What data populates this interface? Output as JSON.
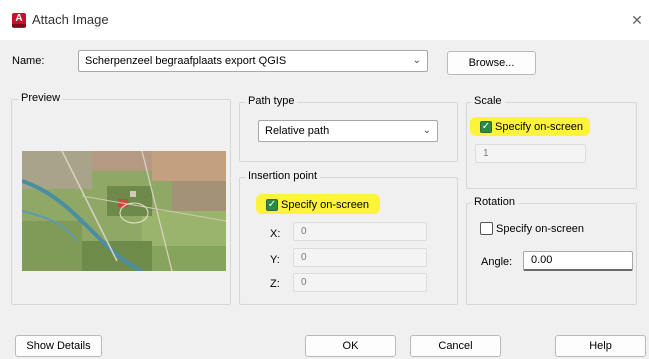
{
  "window": {
    "title": "Attach Image",
    "close_icon": "close-icon"
  },
  "name": {
    "label": "Name:",
    "value": "Scherpenzeel begraafplaats export QGIS",
    "browse_label": "Browse..."
  },
  "preview": {
    "title": "Preview"
  },
  "path_type": {
    "title": "Path type",
    "value": "Relative path"
  },
  "insertion_point": {
    "title": "Insertion point",
    "specify_label": "Specify on-screen",
    "specify_checked": true,
    "x_label": "X:",
    "x_value": "0",
    "y_label": "Y:",
    "y_value": "0",
    "z_label": "Z:",
    "z_value": "0"
  },
  "scale": {
    "title": "Scale",
    "specify_label": "Specify on-screen",
    "specify_checked": true,
    "value": "1"
  },
  "rotation": {
    "title": "Rotation",
    "specify_label": "Specify on-screen",
    "specify_checked": false,
    "angle_label": "Angle:",
    "angle_value": "0.00"
  },
  "footer": {
    "show_details": "Show Details",
    "ok": "OK",
    "cancel": "Cancel",
    "help": "Help"
  },
  "colors": {
    "highlight": "#fdf33b",
    "checkbox": "#2d8a45",
    "brand": "#c8102e"
  }
}
